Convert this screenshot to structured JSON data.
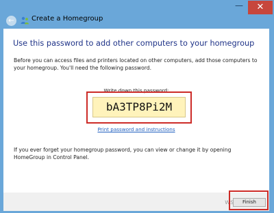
{
  "window": {
    "title": "Create a Homegroup",
    "minimize_glyph": "—",
    "close_glyph": "✕",
    "back_glyph": "←"
  },
  "content": {
    "heading": "Use this password to add other computers to your homegroup",
    "description": "Before you can access files and printers located on other computers, add those computers to your homegroup. You'll need the following password.",
    "password_label": "Write down this password:",
    "password": "bA3TP8Pi2M",
    "print_link": "Print password and instructions",
    "forget_text": "If you ever forget your homegroup password, you can view or change it by opening HomeGroup in Control Panel."
  },
  "footer": {
    "finish_label": "Finish"
  },
  "watermark": "wsxdn.com",
  "colors": {
    "frame": "#6aa7d9",
    "heading": "#1e3287",
    "password_bg": "#fff3bb",
    "highlight": "#cc2a26",
    "link": "#1f5fbf"
  },
  "icons": {
    "back": "back-arrow-icon",
    "homegroup": "homegroup-icon"
  }
}
